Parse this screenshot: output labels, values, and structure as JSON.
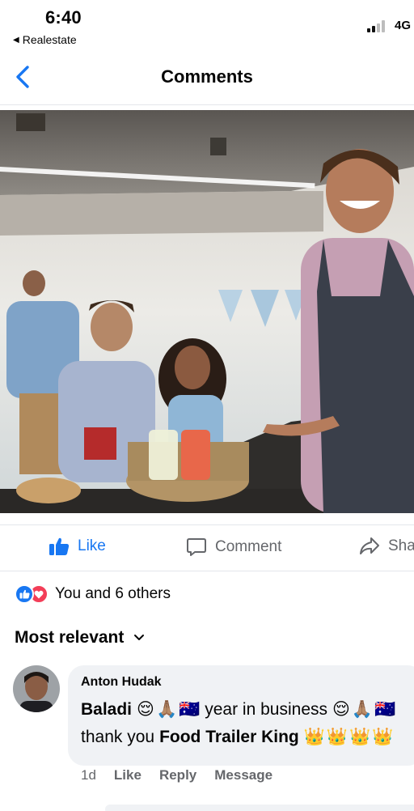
{
  "status_bar": {
    "time": "6:40",
    "back_app": "Realestate",
    "network": "4G"
  },
  "nav": {
    "title": "Comments",
    "back_icon": "chevron-left-icon"
  },
  "post": {
    "actions": {
      "like": "Like",
      "comment": "Comment",
      "share": "Share"
    },
    "reactions_text": "You and 6 others",
    "accent_color": "#1877f2"
  },
  "sort": {
    "label": "Most relevant"
  },
  "comment": {
    "author": "Anton Hudak",
    "line1_text_a": "Baladi",
    "line1_text_b": "year in business",
    "line2_text_a": "thank you",
    "line2_text_b": "Food Trailer King",
    "time_ago": "1d",
    "like": "Like",
    "reply": "Reply",
    "message": "Message"
  }
}
